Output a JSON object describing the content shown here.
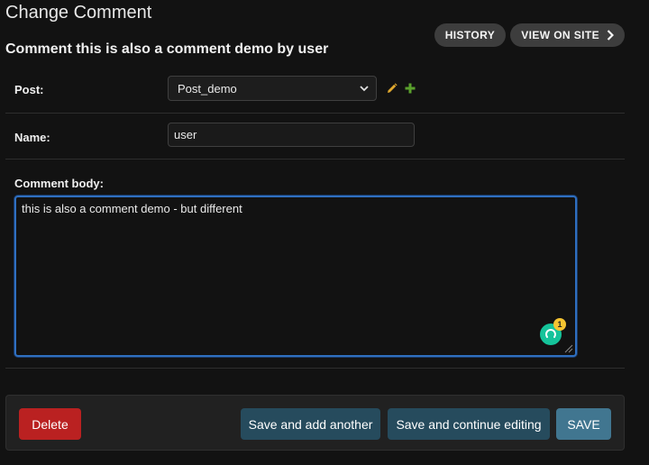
{
  "header": {
    "title": "Change Comment",
    "subtitle": "Comment this is also a comment demo by user"
  },
  "object_tools": {
    "history_label": "HISTORY",
    "view_on_site_label": "VIEW ON SITE"
  },
  "form": {
    "post": {
      "label": "Post:",
      "selected": "Post_demo"
    },
    "name": {
      "label": "Name:",
      "value": "user"
    },
    "comment_body": {
      "label": "Comment body:",
      "value": "this is also a comment demo - but different"
    },
    "grammar_badge_count": "1"
  },
  "submit_row": {
    "delete_label": "Delete",
    "save_add_another_label": "Save and add another",
    "save_continue_label": "Save and continue editing",
    "save_label": "SAVE"
  },
  "icons": {
    "edit": "pencil-icon",
    "add": "plus-icon",
    "dropdown": "chevron-down-icon",
    "view_on_site": "chevron-right-icon"
  },
  "colors": {
    "background": "#121212",
    "delete": "#ba2121",
    "secondary_button": "#264b5d",
    "primary_button": "#417690",
    "focus_border": "#2f6fc0",
    "edit_icon": "#e0a82e",
    "add_icon": "#5aa02c"
  }
}
